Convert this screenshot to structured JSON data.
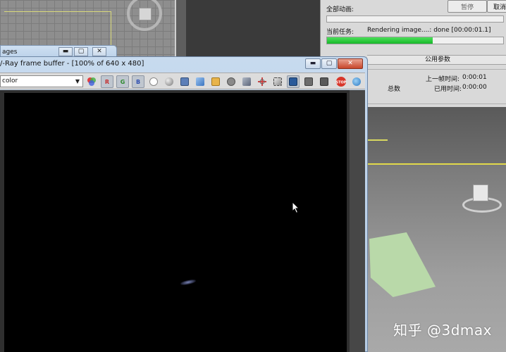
{
  "progress_dialog": {
    "all_animation_label": "全部动画:",
    "pause_label": "暂停",
    "cancel_label": "取消",
    "current_task_label": "当前任务:",
    "current_task_text": "Rendering image....: done [00:00:01.1]",
    "task_progress": 0.6,
    "section_title": "公用参数",
    "total_label": "总数",
    "last_frame_time_label": "上一帧时间:",
    "last_frame_time_value": "0:00:01",
    "elapsed_time_label": "已用时间:",
    "elapsed_time_value": "0:00:00",
    "accent_color": "#22c23a"
  },
  "small_window": {
    "title": "ages",
    "minimize_glyph": "▬",
    "maximize_glyph": "▢",
    "close_glyph": "✕"
  },
  "vfb": {
    "title": "/-Ray frame buffer - [100% of 640 x 480]",
    "channel_value": "color",
    "minimize_glyph": "▬",
    "maximize_glyph": "▢",
    "close_glyph": "✕",
    "toolbar": {
      "red_channel": "R",
      "green_channel": "G",
      "blue_channel": "B",
      "stop_label": "STOP"
    }
  },
  "watermark": "知乎 @3dmax"
}
